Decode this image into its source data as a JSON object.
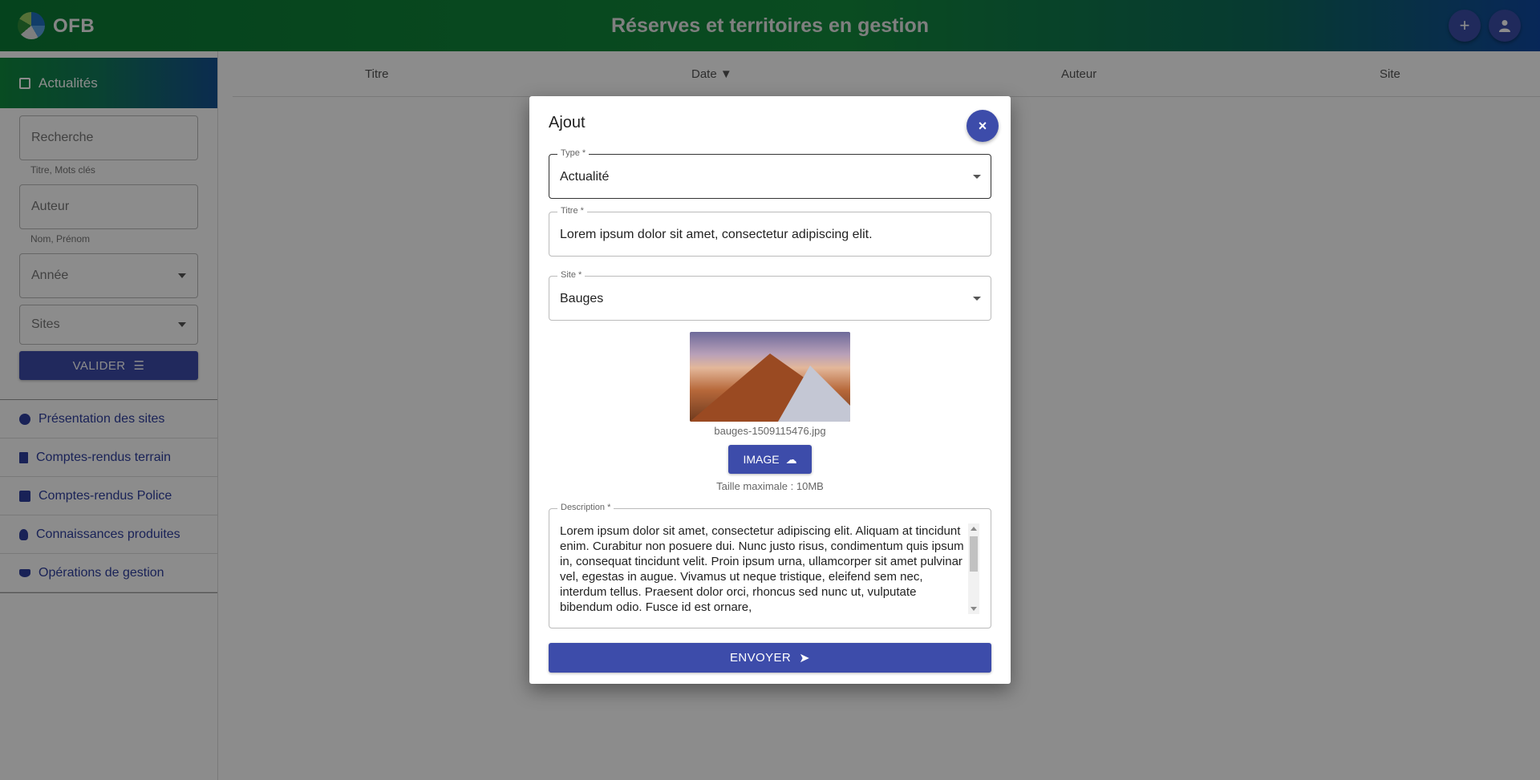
{
  "header": {
    "brand": "OFB",
    "title": "Réserves et territoires en gestion",
    "add_icon": "+",
    "user_icon": "👤"
  },
  "sidebar": {
    "active_item": "Actualités",
    "search": {
      "placeholder": "Recherche",
      "helper": "Titre, Mots clés"
    },
    "author": {
      "placeholder": "Auteur",
      "helper": "Nom, Prénom"
    },
    "year": {
      "placeholder": "Année"
    },
    "sites": {
      "placeholder": "Sites"
    },
    "validate_label": "VALIDER",
    "nav": [
      {
        "label": "Présentation des sites",
        "icon": "info-icon"
      },
      {
        "label": "Comptes-rendus terrain",
        "icon": "document-icon"
      },
      {
        "label": "Comptes-rendus Police",
        "icon": "tools-icon"
      },
      {
        "label": "Connaissances produites",
        "icon": "lightbulb-icon"
      },
      {
        "label": "Opérations de gestion",
        "icon": "boat-icon"
      }
    ]
  },
  "table": {
    "columns": [
      "Titre",
      "Date ▼",
      "Auteur",
      "Site"
    ]
  },
  "dialog": {
    "title": "Ajout",
    "close_icon": "×",
    "type": {
      "label": "Type *",
      "value": "Actualité"
    },
    "titre": {
      "label": "Titre *",
      "value": "Lorem ipsum dolor sit amet, consectetur adipiscing elit."
    },
    "site": {
      "label": "Site *",
      "value": "Bauges"
    },
    "image": {
      "filename": "bauges-1509115476.jpg",
      "button_label": "IMAGE",
      "max_size": "Taille maximale : 10MB"
    },
    "description": {
      "label": "Description *",
      "value": "Lorem ipsum dolor sit amet, consectetur adipiscing elit. Aliquam at tincidunt enim. Curabitur non posuere dui. Nunc justo risus, condimentum quis ipsum in, consequat tincidunt velit. Proin ipsum urna, ullamcorper sit amet pulvinar vel, egestas in augue. Vivamus ut neque tristique, eleifend sem nec, interdum tellus. Praesent dolor orci, rhoncus sed nunc ut, vulputate bibendum odio. Fusce id est ornare,"
    },
    "send_label": "ENVOYER"
  }
}
